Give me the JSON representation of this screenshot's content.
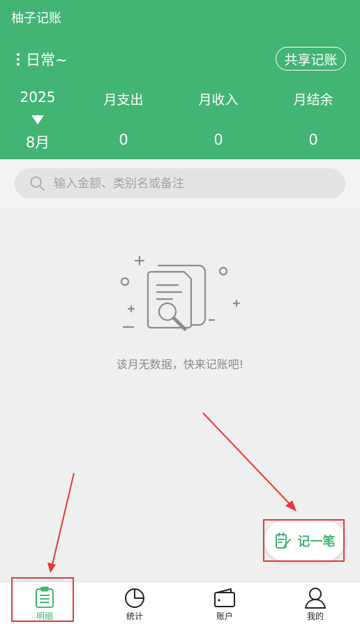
{
  "app": {
    "title": "柚子记账"
  },
  "header": {
    "book_name": "日常~",
    "share_label": "共享记账",
    "year": "2025",
    "month": "8月",
    "stats": [
      {
        "label": "月支出",
        "value": "0"
      },
      {
        "label": "月收入",
        "value": "0"
      },
      {
        "label": "月结余",
        "value": "0"
      }
    ]
  },
  "search": {
    "placeholder": "输入金额、类别名或备注"
  },
  "empty": {
    "message": "该月无数据，快来记账吧!"
  },
  "fab": {
    "label": "记一笔",
    "icon": "notepad-pen-icon"
  },
  "tabs": [
    {
      "label": "明细",
      "icon": "clipboard-list-icon",
      "active": true
    },
    {
      "label": "统计",
      "icon": "pie-chart-icon",
      "active": false
    },
    {
      "label": "账户",
      "icon": "wallet-icon",
      "active": false
    },
    {
      "label": "我的",
      "icon": "person-icon",
      "active": false
    }
  ],
  "colors": {
    "primary": "#42b474",
    "annotation": "#e53935",
    "background": "#efefef"
  }
}
